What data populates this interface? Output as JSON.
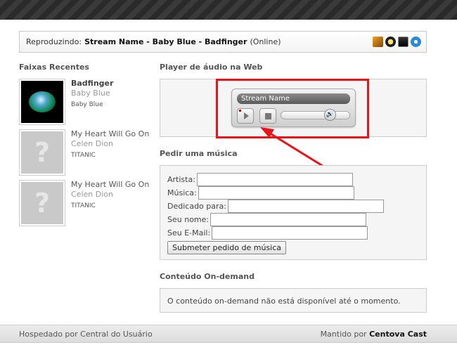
{
  "now_playing": {
    "label": "Reproduzindo:",
    "track": "Stream Name - Baby Blue - Badfinger",
    "status": "(Online)",
    "icons": [
      "winamp-icon",
      "media-player-icon",
      "quicktime-icon",
      "realplayer-icon"
    ]
  },
  "recent": {
    "heading": "Faixas Recentes",
    "tracks": [
      {
        "title": "Badfinger",
        "artist": "Baby Blue",
        "album": "Baby Blue",
        "has_cover": true
      },
      {
        "title": "My Heart Will Go On",
        "artist": "Celen Dion",
        "album": "TITANIC",
        "has_cover": false
      },
      {
        "title": "My Heart Will Go On",
        "artist": "Celen Dion",
        "album": "TITANIC",
        "has_cover": false
      }
    ],
    "placeholder_glyph": "?"
  },
  "player": {
    "heading": "Player de áudio na Web",
    "stream_title": "Stream Name",
    "volume_glyph": "🔊"
  },
  "request": {
    "heading": "Pedir uma música",
    "fields": [
      {
        "label": "Artista:",
        "value": ""
      },
      {
        "label": "Música:",
        "value": ""
      },
      {
        "label": "Dedicado para:",
        "value": ""
      },
      {
        "label": "Seu nome:",
        "value": ""
      },
      {
        "label": "Seu E-Mail:",
        "value": ""
      }
    ],
    "submit_label": "Submeter pedido de música"
  },
  "ondemand": {
    "heading": "Conteúdo On-demand",
    "message": "O conteúdo on-demand não está disponível até o momento."
  },
  "footer": {
    "left": "Hospedado por Central do Usuário",
    "right_prefix": "Mantido por",
    "right_brand": "Centova Cast"
  },
  "colors": {
    "annotation": "#e8141a"
  }
}
